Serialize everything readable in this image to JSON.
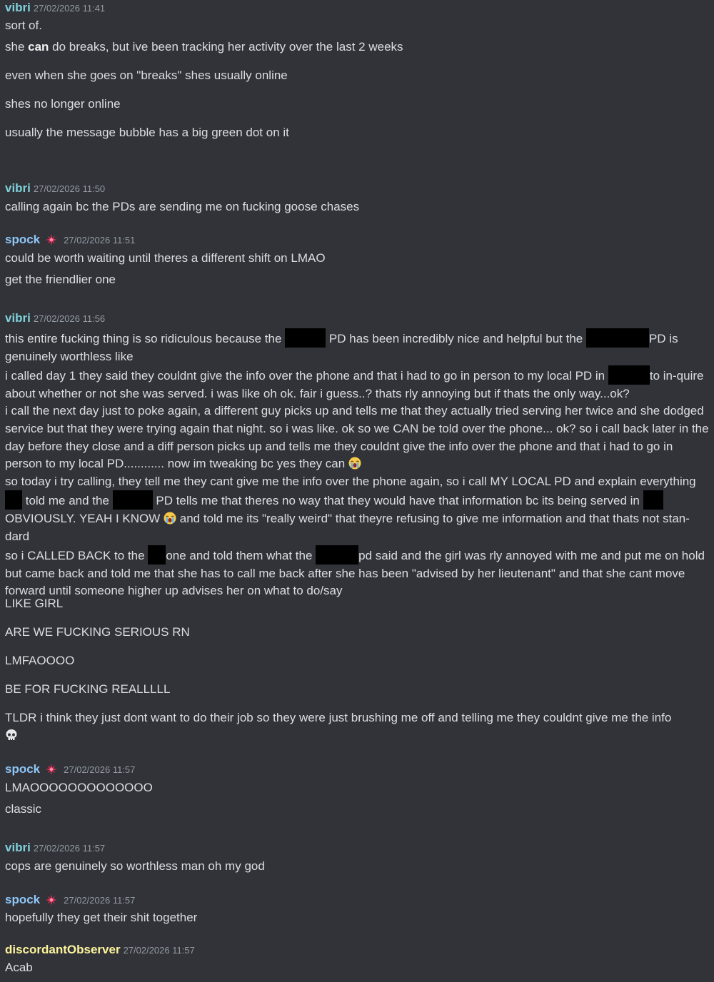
{
  "users": {
    "vibri": {
      "name": "vibri",
      "color": "#7fd0da"
    },
    "spock": {
      "name": "spock",
      "color": "#8ec6f8"
    },
    "discordant": {
      "name": "discordantObserver",
      "color": "#fdf49c"
    }
  },
  "badge_icon": "sparkle-burst-icon",
  "emoji": {
    "cry": "loudly-crying-face-icon",
    "skull": "skull-icon"
  },
  "messages": [
    {
      "user": "vibri",
      "timestamp": "27/02/2026 11:41",
      "lines": [
        "sort of.",
        {
          "pre": "she ",
          "bold": "can",
          "post": " do breaks, but ive been tracking her activity over the last 2 weeks"
        },
        "even when she goes on \"breaks\" shes usually online",
        "shes no longer online",
        "usually the message bubble has a big green dot on it"
      ]
    },
    {
      "user": "vibri",
      "timestamp": "27/02/2026 11:50",
      "lines": [
        "calling again bc the PDs are sending me on fucking goose chases"
      ]
    },
    {
      "user": "spock",
      "timestamp": "27/02/2026 11:51",
      "lines": [
        "could be worth waiting until theres a different shift on LMAO",
        "get the friendlier one"
      ]
    },
    {
      "user": "vibri",
      "timestamp": "27/02/2026 11:56",
      "paragraph": {
        "p1a": "this entire fucking thing is so ridiculous because the ",
        "p1b": " PD has been incredibly nice and helpful but the ",
        "p1c": "PD is genuinely worthless like",
        "p2a": "i called day 1 they said they couldnt give the info over the phone and that i had to go in person to my local PD in ",
        "p2b": "to in-quire about whether or not she was served. i was like oh ok. fair i guess..? thats rly annoying but if thats the only way...ok?",
        "p3": "i call the next day just to poke again, a different guy picks up and tells me that they actually tried serving her twice and she dodged service but that they were trying again that night. so i was like. ok so we CAN be told over the phone... ok? so i call back later in the day before they close and a diff person picks up and tells me they couldnt give the info over the phone and that i had to go in person to my local PD............ now im tweaking bc yes they can ",
        "p4a": "so today i try calling, they tell me they cant give me the info over the phone again, so i call MY LOCAL PD and explain everything ",
        "p4b": " told me and the ",
        "p4c": " PD tells me that theres no way that they would have that information bc its being served in ",
        "p4d": "OBVIOUSLY. YEAH I KNOW ",
        "p4e": " and told me its \"really weird\" that theyre refusing to give me information and that thats not stan-dard",
        "p5a": "so i CALLED BACK to the ",
        "p5b": "one and told them what the ",
        "p5c": "pd said and the girl was rly annoyed with me and put me on hold but came back and told me that she has to call me back after she has been \"advised by her lieutenant\" and that she cant move forward until someone higher up advises her on what to do/say"
      },
      "lines": [
        "LIKE GIRL",
        "ARE WE FUCKING SERIOUS RN",
        "LMFAOOOO",
        "BE FOR FUCKING REALLLLL",
        "TLDR i think they just dont want to do their job so they were just brushing me off and telling me they couldnt give me the info"
      ]
    },
    {
      "user": "spock",
      "timestamp": "27/02/2026 11:57",
      "lines": [
        "LMAOOOOOOOOOOOOO",
        "classic"
      ]
    },
    {
      "user": "vibri",
      "timestamp": "27/02/2026 11:57",
      "lines": [
        "cops are genuinely so worthless man oh my god"
      ]
    },
    {
      "user": "spock",
      "timestamp": "27/02/2026 11:57",
      "lines": [
        "hopefully they get their shit together"
      ]
    },
    {
      "user": "discordant",
      "timestamp": "27/02/2026 11:57",
      "lines": [
        "Acab"
      ]
    }
  ]
}
